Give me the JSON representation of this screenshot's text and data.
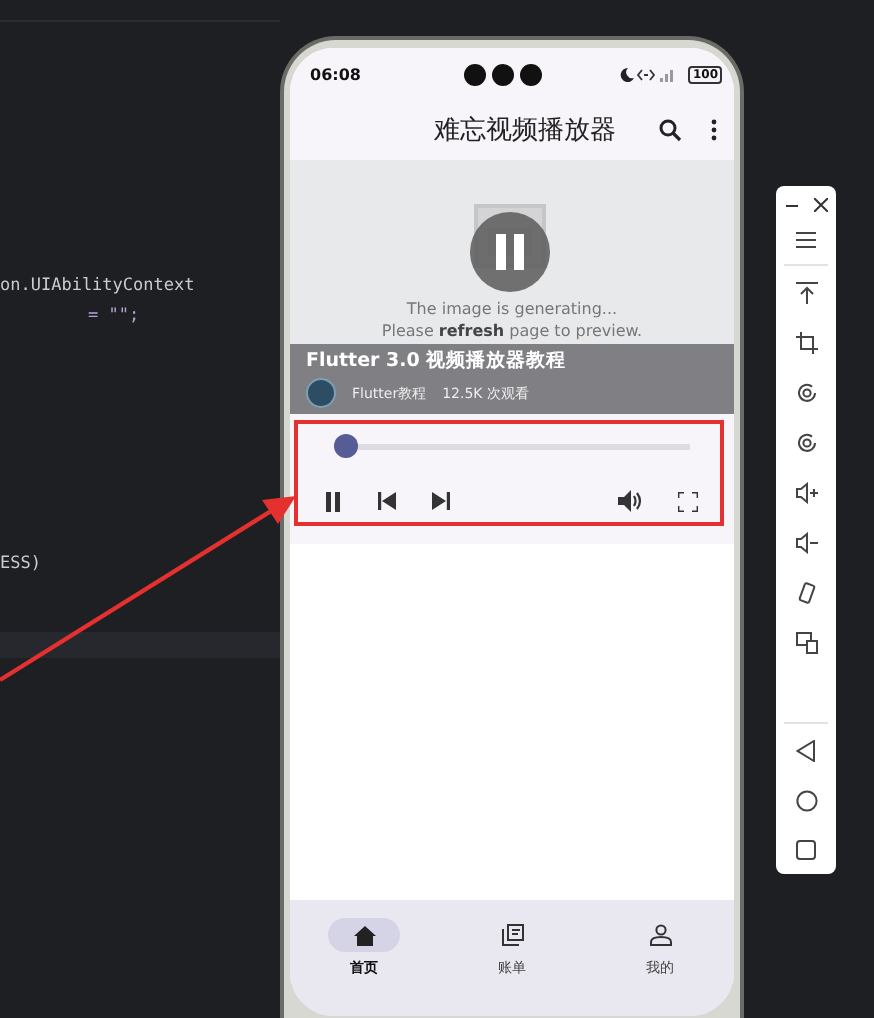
{
  "editor": {
    "lines": [
      {
        "text": "on.UIAbilityContext"
      },
      {
        "text": "= \"\";"
      },
      {
        "text": "ESS)"
      }
    ]
  },
  "phone": {
    "status_bar": {
      "time": "06:08",
      "battery": "100"
    },
    "app_bar": {
      "title": "难忘视频播放器"
    },
    "video": {
      "placeholder_lines": [
        "The image is generating...",
        "Please **refresh** page to preview."
      ],
      "title": "Flutter 3.0 视频播放器教程",
      "channel": "Flutter教程",
      "views": "12.5K 次观看",
      "playing": true
    },
    "player": {
      "level": 0.0
    },
    "nav": [
      {
        "label": "首页",
        "selected": true
      },
      {
        "label": "账单",
        "selected": false
      },
      {
        "label": "我的",
        "selected": false
      }
    ]
  }
}
